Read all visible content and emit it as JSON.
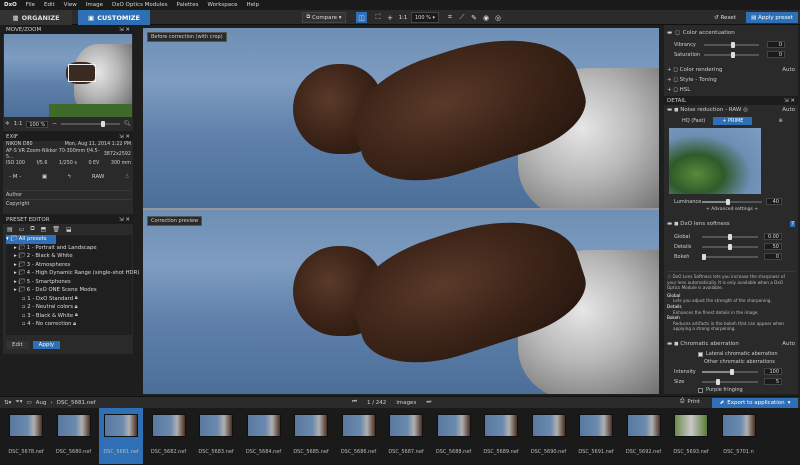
{
  "menu": {
    "logo": "DxO",
    "items": [
      "File",
      "Edit",
      "View",
      "Image",
      "DxO Optics Modules",
      "Palettes",
      "Workspace",
      "Help"
    ]
  },
  "toolbar": {
    "organize": "ORGANIZE",
    "customize": "CUSTOMIZE",
    "compare": "Compare",
    "ratio": "1:1",
    "zoom": "100 %",
    "reset": "Reset",
    "apply_preset": "Apply preset"
  },
  "movezoom": {
    "title": "MOVE/ZOOM",
    "ratio": "1:1",
    "zoom": "100 %"
  },
  "exif": {
    "title": "EXIF",
    "camera": "NIKON D80",
    "date": "Mon, Aug 11, 2014 1:22 PM",
    "lens": "AF-S VR Zoom-Nikkor 70-300mm f/4.5-5...",
    "dims": "3872x2592",
    "iso": "ISO 100",
    "aperture": "f/5.6",
    "shutter": "1/250 s",
    "ev": "0 EV",
    "focal": "300 mm",
    "mode": "- M -",
    "raw": "RAW",
    "author_label": "Author",
    "copyright_label": "Copyright"
  },
  "preset_editor": {
    "title": "PRESET EDITOR",
    "tree": [
      "All presets",
      "1 - Portrait and Landscape",
      "2 - Black & White",
      "3 - Atmospheres",
      "4 - High Dynamic Range (single-shot HDR)",
      "5 - Smartphones",
      "6 - DxO ONE Scene Modes",
      "1 - DxO Standard",
      "2 - Neutral colors",
      "3 - Black & White",
      "4 - No correction"
    ],
    "edit": "Edit",
    "apply": "Apply"
  },
  "viewer": {
    "before_label": "Before correction (with crop)",
    "after_label": "Correction preview"
  },
  "right_top": {
    "color_accentuation": "Color accentuation",
    "vibrancy": "Vibrancy",
    "vibrancy_val": "0",
    "saturation": "Saturation",
    "saturation_val": "0",
    "color_rendering": "Color rendering",
    "color_rendering_mode": "Auto",
    "style_toning": "Style - Toning",
    "hsl": "HSL"
  },
  "detail": {
    "title": "DETAIL",
    "noise": "Noise reduction - RAW",
    "noise_mode": "Auto",
    "hq": "HQ (Fast)",
    "prime": "PRIME",
    "luminance": "Luminance",
    "luminance_val": "40",
    "advanced": "+ Advanced settings +",
    "lens_softness": "DxO lens softness",
    "global": "Global",
    "global_val": "0.00",
    "details": "Details",
    "details_val": "50",
    "bokeh": "Bokeh",
    "bokeh_val": "0",
    "help_intro": "DxO Lens Softness lets you increase the sharpness of your lens automatically. It is only available when a DxO Optics Module is available.",
    "help_global_t": "Global",
    "help_global": "Lets you adjust the strength of the sharpening.",
    "help_details_t": "Details",
    "help_details": "Enhances the finest details in the image.",
    "help_bokeh_t": "Bokeh",
    "help_bokeh": "Reduces artifacts in the bokeh that can appear when applying a strong sharpening.",
    "chromatic": "Chromatic aberration",
    "chromatic_mode": "Auto",
    "lateral": "Lateral chromatic aberration",
    "other": "Other chromatic aberrations",
    "intensity": "Intensity",
    "intensity_val": "100",
    "size": "Size",
    "size_val": "5",
    "purple": "Purple fringing"
  },
  "filmbar": {
    "folder": "Aug",
    "file": "DSC_5681.nef",
    "counter": "1 / 242",
    "images": "images",
    "print": "Print",
    "export": "Export to application"
  },
  "thumbs": [
    "DSC_5678.nef",
    "DSC_5680.nef",
    "DSC_5681.nef",
    "DSC_5682.nef",
    "DSC_5683.nef",
    "DSC_5684.nef",
    "DSC_5685.nef",
    "DSC_5686.nef",
    "DSC_5687.nef",
    "DSC_5688.nef",
    "DSC_5689.nef",
    "DSC_5690.nef",
    "DSC_5691.nef",
    "DSC_5692.nef",
    "DSC_5693.nef",
    "DSC_5701.n"
  ],
  "colors": {
    "accent": "#2e6fb5",
    "bg": "#1e1e1e",
    "panel": "#2a2a2a"
  }
}
